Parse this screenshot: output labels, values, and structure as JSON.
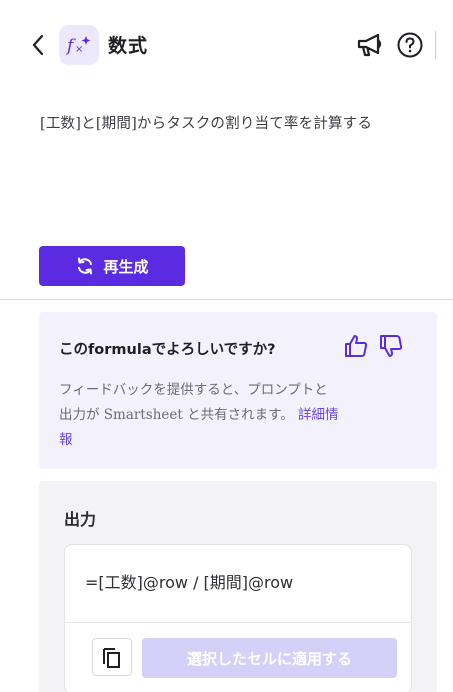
{
  "header": {
    "title": "数式",
    "icons": [
      "chevron-left-icon",
      "formula-sparkle-icon",
      "megaphone-icon",
      "help-icon"
    ]
  },
  "prompt": {
    "text": "[工数]と[期間]からタスクの割り当て率を計算する"
  },
  "regenerate": {
    "label": "再生成",
    "icon": "refresh-icon"
  },
  "feedback": {
    "question": "このformulaでよろしいですか?",
    "description": "フィードバックを提供すると、プロンプトと出力が Smartsheet と共有されます。",
    "link": "詳細情報",
    "icons": [
      "thumbs-up-icon",
      "thumbs-down-icon"
    ]
  },
  "output": {
    "label": "出力",
    "formula": "=[工数]@row / [期間]@row",
    "apply_label": "選択したセルに適用する",
    "copy_icon": "copy-icon"
  },
  "colors": {
    "accent": "#5a2be0",
    "accent_disabled": "#d5d0f7",
    "feedback_bg": "#f3f1fc",
    "link": "#6a44e4"
  }
}
